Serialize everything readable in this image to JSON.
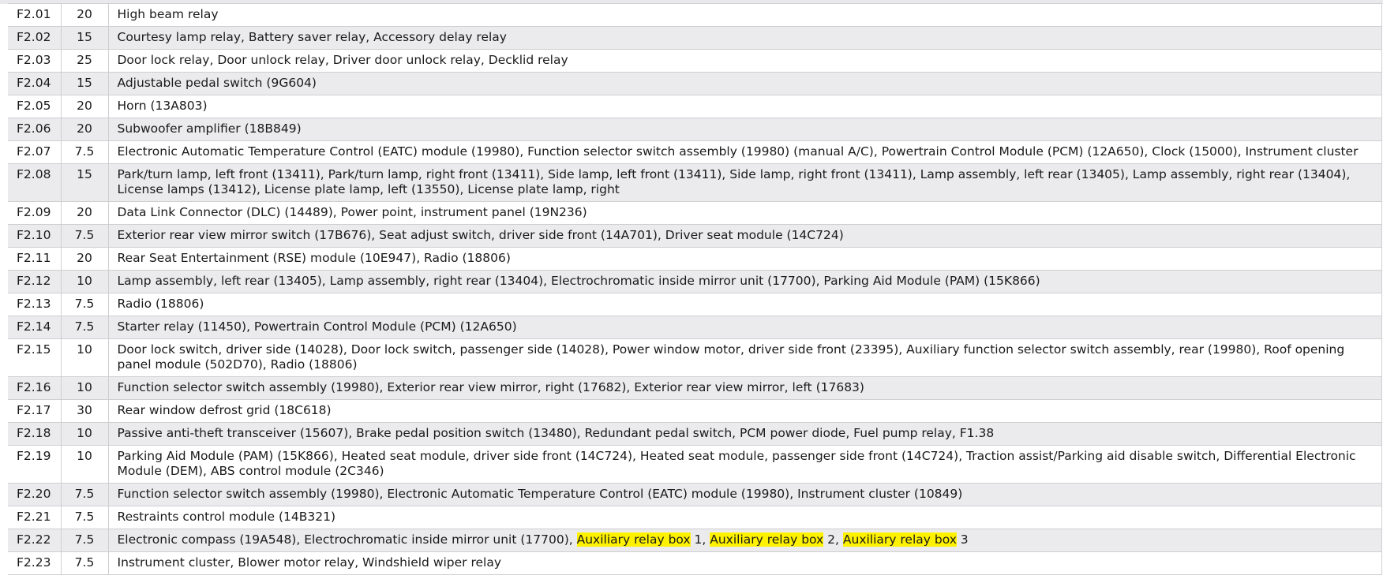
{
  "rows": [
    {
      "pos": "F2.01",
      "amp": "20",
      "desc": "High beam relay"
    },
    {
      "pos": "F2.02",
      "amp": "15",
      "desc": "Courtesy lamp relay, Battery saver relay, Accessory delay relay"
    },
    {
      "pos": "F2.03",
      "amp": "25",
      "desc": "Door lock relay, Door unlock relay, Driver door unlock relay, Decklid relay"
    },
    {
      "pos": "F2.04",
      "amp": "15",
      "desc": "Adjustable pedal switch (9G604)"
    },
    {
      "pos": "F2.05",
      "amp": "20",
      "desc": "Horn (13A803)"
    },
    {
      "pos": "F2.06",
      "amp": "20",
      "desc": "Subwoofer amplifier (18B849)"
    },
    {
      "pos": "F2.07",
      "amp": "7.5",
      "desc": "Electronic Automatic Temperature Control (EATC) module (19980), Function selector switch assembly (19980) (manual A/C), Powertrain Control Module (PCM) (12A650), Clock (15000), Instrument cluster"
    },
    {
      "pos": "F2.08",
      "amp": "15",
      "desc": "Park/turn lamp, left front (13411), Park/turn lamp, right front (13411), Side lamp, left front (13411), Side lamp, right front (13411), Lamp assembly, left rear (13405), Lamp assembly, right rear (13404), License lamps (13412), License plate lamp, left (13550), License plate lamp, right"
    },
    {
      "pos": "F2.09",
      "amp": "20",
      "desc": "Data Link Connector (DLC) (14489), Power point, instrument panel (19N236)"
    },
    {
      "pos": "F2.10",
      "amp": "7.5",
      "desc": "Exterior rear view mirror switch (17B676), Seat adjust switch, driver side front (14A701), Driver seat module (14C724)"
    },
    {
      "pos": "F2.11",
      "amp": "20",
      "desc": "Rear Seat Entertainment (RSE) module (10E947), Radio (18806)"
    },
    {
      "pos": "F2.12",
      "amp": "10",
      "desc": "Lamp assembly, left rear (13405), Lamp assembly, right rear (13404), Electrochromatic inside mirror unit (17700), Parking Aid Module (PAM) (15K866)"
    },
    {
      "pos": "F2.13",
      "amp": "7.5",
      "desc": "Radio (18806)"
    },
    {
      "pos": "F2.14",
      "amp": "7.5",
      "desc": "Starter relay (11450), Powertrain Control Module (PCM) (12A650)"
    },
    {
      "pos": "F2.15",
      "amp": "10",
      "desc": "Door lock switch, driver side (14028), Door lock switch, passenger side (14028), Power window motor, driver side front (23395), Auxiliary function selector switch assembly, rear (19980), Roof opening panel module (502D70), Radio (18806)"
    },
    {
      "pos": "F2.16",
      "amp": "10",
      "desc": "Function selector switch assembly (19980), Exterior rear view mirror, right (17682), Exterior rear view mirror, left (17683)"
    },
    {
      "pos": "F2.17",
      "amp": "30",
      "desc": "Rear window defrost grid (18C618)"
    },
    {
      "pos": "F2.18",
      "amp": "10",
      "desc": "Passive anti-theft transceiver (15607), Brake pedal position switch (13480), Redundant pedal switch, PCM power diode, Fuel pump relay, F1.38"
    },
    {
      "pos": "F2.19",
      "amp": "10",
      "desc": "Parking Aid Module (PAM) (15K866), Heated seat module, driver side front (14C724), Heated seat module, passenger side front (14C724), Traction assist/Parking aid disable switch, Differential Electronic Module (DEM), ABS control module (2C346)"
    },
    {
      "pos": "F2.20",
      "amp": "7.5",
      "desc": "Function selector switch assembly (19980), Electronic Automatic Temperature Control (EATC) module (19980), Instrument cluster (10849)"
    },
    {
      "pos": "F2.21",
      "amp": "7.5",
      "desc": "Restraints control module (14B321)"
    }
  ],
  "row22": {
    "pos": "F2.22",
    "amp": "7.5",
    "desc_start": "Electronic compass (19A548), Electrochromatic inside mirror unit (17700), ",
    "hl1": "Auxiliary relay box",
    "sep1": " 1, ",
    "hl2": "Auxiliary relay box",
    "sep2": " 2, ",
    "hl3": "Auxiliary relay box",
    "sep3": " 3"
  },
  "row23": {
    "pos": "F2.23",
    "amp": "7.5",
    "desc": "Instrument cluster, Blower motor relay, Windshield wiper relay"
  },
  "colors": {
    "stripe": "#ebebed",
    "border": "#cfcfd2",
    "highlight": "#fff200"
  }
}
